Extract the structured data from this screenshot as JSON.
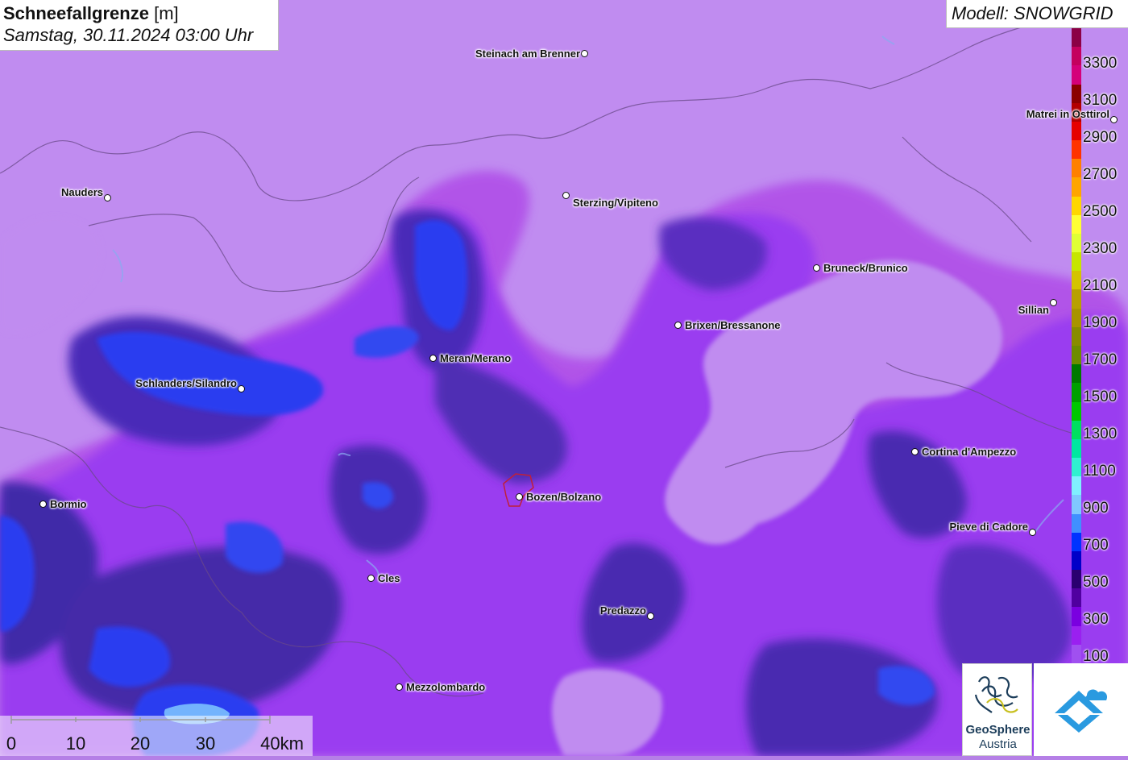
{
  "header": {
    "title_bold": "Schneefallgrenze",
    "title_unit": "[m]",
    "datetime": "Samstag, 30.11.2024 03:00 Uhr"
  },
  "model": {
    "label": "Modell: SNOWGRID"
  },
  "legend": {
    "labels": [
      "3300",
      "3100",
      "2900",
      "2700",
      "2500",
      "2300",
      "2100",
      "1900",
      "1700",
      "1500",
      "1300",
      "1100",
      "900",
      "700",
      "500",
      "300",
      "100"
    ],
    "colors": [
      "#8b0045",
      "#c4005e",
      "#d4007a",
      "#8b0000",
      "#b30000",
      "#e60000",
      "#ff3300",
      "#ff8000",
      "#ffa500",
      "#ffd700",
      "#ffff33",
      "#e0ff33",
      "#c6e600",
      "#d4c400",
      "#b8a000",
      "#a89400",
      "#888c00",
      "#6e8c00",
      "#007a00",
      "#00a000",
      "#00c800",
      "#00e060",
      "#00e6a0",
      "#30f0d0",
      "#80f0ff",
      "#80c8ff",
      "#4090ff",
      "#0033ff",
      "#0000c8",
      "#2a0070",
      "#5000a0",
      "#7a00e0",
      "#9a20f0",
      "#a050f0"
    ]
  },
  "cities": [
    {
      "name": "Steinach am Brenner"
    },
    {
      "name": "Nauders"
    },
    {
      "name": "Sterzing/Vipiteno"
    },
    {
      "name": "Matrei in Osttirol"
    },
    {
      "name": "Bruneck/Brunico"
    },
    {
      "name": "Sillian"
    },
    {
      "name": "Brixen/Bressanone"
    },
    {
      "name": "Meran/Merano"
    },
    {
      "name": "Schlanders/Silandro"
    },
    {
      "name": "Cortina d'Ampezzo"
    },
    {
      "name": "Bozen/Bolzano"
    },
    {
      "name": "Bormio"
    },
    {
      "name": "Pieve di Cadore"
    },
    {
      "name": "Cles"
    },
    {
      "name": "Predazzo"
    },
    {
      "name": "Mezzolombardo"
    }
  ],
  "scale": {
    "labels": [
      "0",
      "10",
      "20",
      "30",
      "40km"
    ]
  },
  "logos": {
    "geosphere_line1": "GeoSphere",
    "geosphere_line2": "Austria"
  },
  "colors": {
    "high_snowline": "#c08cf0",
    "mid_snowline": "#9a3cf0",
    "low_snowline": "#6a22c8",
    "lowest_snowline": "#3a2aa8",
    "blue_zone": "#2a3cf0"
  }
}
